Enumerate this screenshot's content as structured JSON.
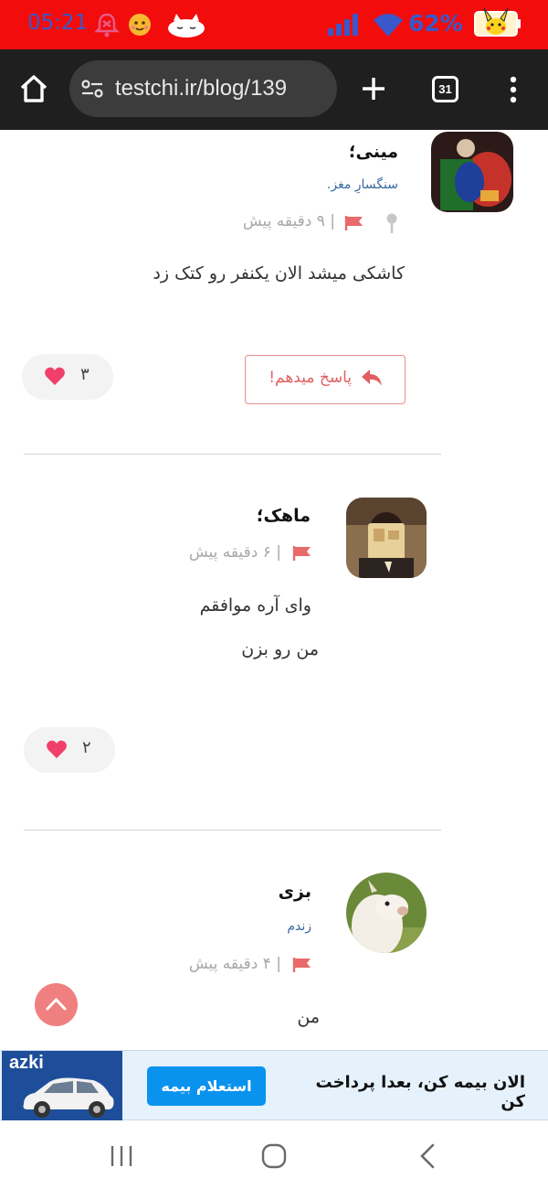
{
  "status_bar": {
    "time": "05:21",
    "battery": "62%",
    "icons": [
      "bell-off-icon",
      "emoji-icon",
      "cat-icon",
      "signal-icon",
      "wifi-icon",
      "battery-icon"
    ]
  },
  "browser": {
    "url": "testchi.ir/blog/139",
    "tab_count": "31"
  },
  "comments": [
    {
      "name": "مینی؛",
      "bio": "سنگسارِ مغز.",
      "time": "۹ دقیقه پیش",
      "separator": "|",
      "lines": [
        "کاشکی میشد الان یکنفر رو کتک زد"
      ],
      "likes": "۳",
      "reply_label": "پاسخ میدهم!"
    },
    {
      "name": "ماهک؛",
      "bio": "",
      "time": "۶ دقیقه پیش",
      "separator": "|",
      "lines": [
        "وای آره موافقم",
        "من رو بزن"
      ],
      "likes": "۲"
    },
    {
      "name": "بزی",
      "bio": "زندم",
      "time": "۴ دقیقه پیش",
      "separator": "|",
      "lines": [
        "من"
      ]
    }
  ],
  "ad": {
    "brand": "azki",
    "cta": "استعلام بیمه",
    "headline": "الان بیمه کن، بعدا پرداخت کن"
  },
  "colors": {
    "status_bar": "#f20c0c",
    "status_text": "#3a58c9",
    "toolbar": "#1f1f1f",
    "flag": "#e86a6a",
    "heart": "#f0406a",
    "bio_link": "#3b6aa1",
    "cta": "#0a93ee"
  }
}
